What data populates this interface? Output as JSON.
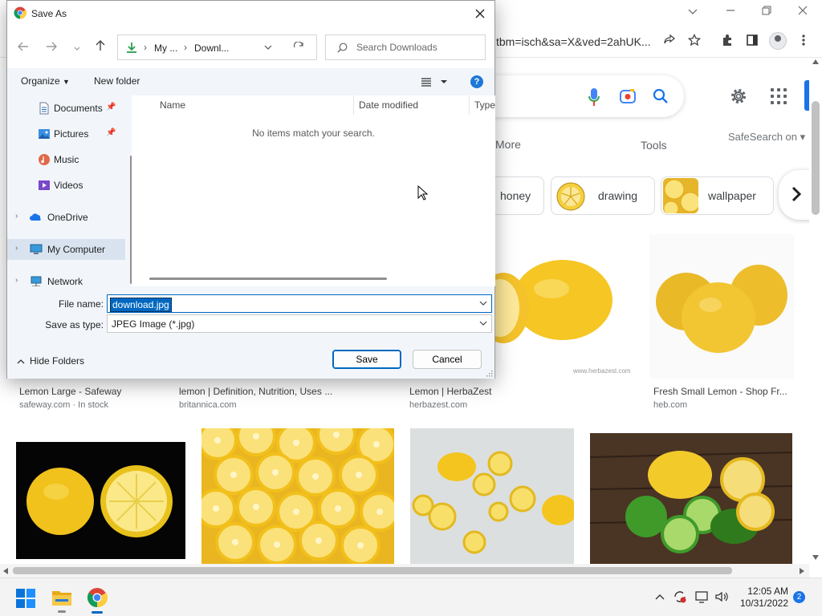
{
  "dialog": {
    "title": "Save As",
    "breadcrumb": [
      "My ...",
      "Downl..."
    ],
    "search_placeholder": "Search Downloads",
    "toolbar": {
      "organize": "Organize",
      "new_folder": "New folder"
    },
    "nav_items": [
      {
        "label": "Documents",
        "icon": "documents-icon",
        "pinned": true
      },
      {
        "label": "Pictures",
        "icon": "pictures-icon",
        "pinned": true
      },
      {
        "label": "Music",
        "icon": "music-icon",
        "pinned": false
      },
      {
        "label": "Videos",
        "icon": "videos-icon",
        "pinned": false
      },
      {
        "label": "OneDrive",
        "icon": "onedrive-icon",
        "expandable": true
      },
      {
        "label": "My Computer",
        "icon": "computer-icon",
        "expandable": true,
        "selected": true
      },
      {
        "label": "Network",
        "icon": "network-icon",
        "expandable": true
      }
    ],
    "columns": {
      "name": "Name",
      "date_modified": "Date modified",
      "type": "Type"
    },
    "empty_message": "No items match your search.",
    "file_name_label": "File name:",
    "file_name_value": "download.jpg",
    "save_type_label": "Save as type:",
    "save_type_value": "JPEG Image (*.jpg)",
    "hide_folders": "Hide Folders",
    "save_button": "Save",
    "cancel_button": "Cancel"
  },
  "browser": {
    "url_fragment": "tbm=isch&sa=X&ved=2ahUK...",
    "nav": {
      "more": "More",
      "tools": "Tools",
      "safesearch": "SafeSearch on"
    },
    "chips": [
      {
        "label": "honey"
      },
      {
        "label": "drawing"
      },
      {
        "label": "wallpaper"
      }
    ],
    "results_row1": [
      {
        "title": "Lemon Large - Safeway",
        "source": "safeway.com · In stock"
      },
      {
        "title": "lemon | Definition, Nutrition, Uses ...",
        "source": "britannica.com"
      },
      {
        "title": "Lemon | HerbaZest",
        "source": "herbazest.com"
      },
      {
        "title": "Fresh Small Lemon - Shop Fr...",
        "source": "heb.com"
      }
    ],
    "watermark": "www.herbazest.com"
  },
  "taskbar": {
    "time": "12:05 AM",
    "date": "10/31/2022",
    "notifications": "2"
  },
  "colors": {
    "accent": "#0067c0",
    "google_blue": "#1a73e8",
    "lemon": "#f6c624"
  }
}
